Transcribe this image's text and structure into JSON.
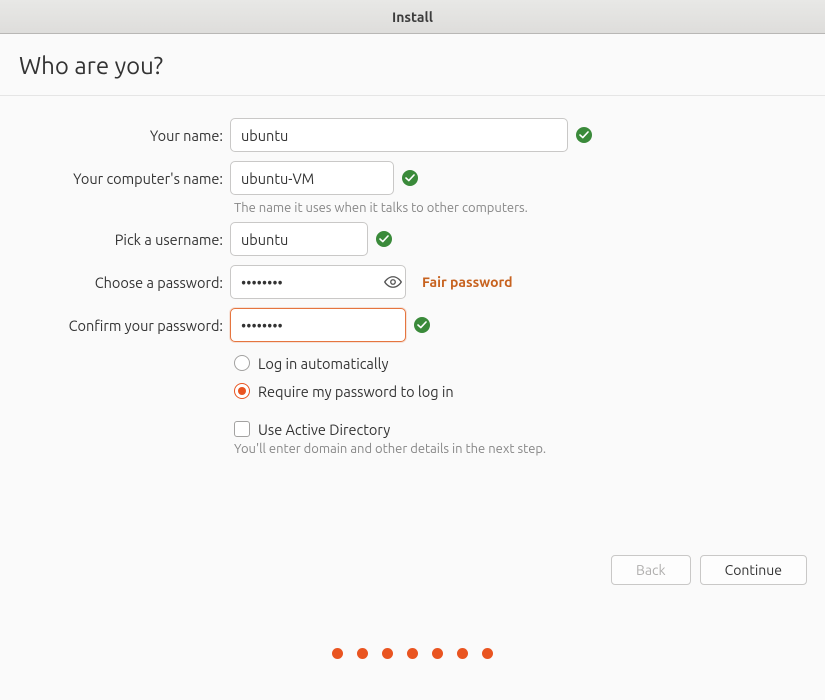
{
  "window": {
    "title": "Install"
  },
  "page": {
    "heading": "Who are you?"
  },
  "labels": {
    "your_name": "Your name:",
    "computer_name": "Your computer's name:",
    "username": "Pick a username:",
    "password": "Choose a password:",
    "confirm": "Confirm your password:"
  },
  "fields": {
    "your_name": "ubuntu",
    "computer_name": "ubuntu-VM",
    "username": "ubuntu",
    "password": "••••••••",
    "confirm": "••••••••"
  },
  "hints": {
    "computer_name": "The name it uses when it talks to other computers.",
    "active_directory": "You'll enter domain and other details in the next step."
  },
  "password_strength": "Fair password",
  "options": {
    "login_auto": "Log in automatically",
    "login_password": "Require my password to log in",
    "active_directory": "Use Active Directory",
    "selected_login": "password",
    "use_active_directory": false
  },
  "buttons": {
    "back": "Back",
    "continue": "Continue"
  },
  "validation": {
    "your_name": true,
    "computer_name": true,
    "username": true,
    "confirm": true
  },
  "progress": {
    "total": 7
  },
  "colors": {
    "accent": "#e95420",
    "valid": "#3a8a3a",
    "strength": "#c7621f"
  }
}
